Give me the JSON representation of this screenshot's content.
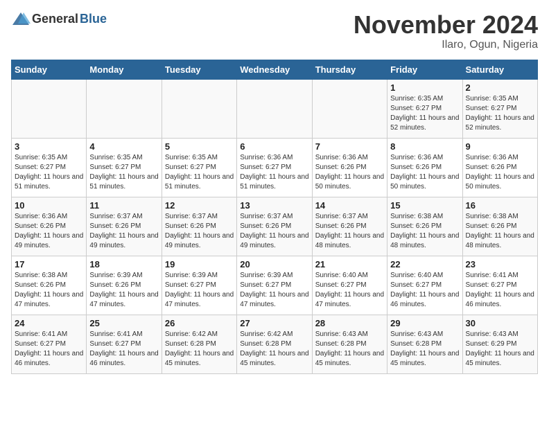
{
  "header": {
    "logo_general": "General",
    "logo_blue": "Blue",
    "month_title": "November 2024",
    "location": "Ilaro, Ogun, Nigeria"
  },
  "calendar": {
    "days_of_week": [
      "Sunday",
      "Monday",
      "Tuesday",
      "Wednesday",
      "Thursday",
      "Friday",
      "Saturday"
    ],
    "weeks": [
      [
        {
          "day": "",
          "info": ""
        },
        {
          "day": "",
          "info": ""
        },
        {
          "day": "",
          "info": ""
        },
        {
          "day": "",
          "info": ""
        },
        {
          "day": "",
          "info": ""
        },
        {
          "day": "1",
          "info": "Sunrise: 6:35 AM\nSunset: 6:27 PM\nDaylight: 11 hours and 52 minutes."
        },
        {
          "day": "2",
          "info": "Sunrise: 6:35 AM\nSunset: 6:27 PM\nDaylight: 11 hours and 52 minutes."
        }
      ],
      [
        {
          "day": "3",
          "info": "Sunrise: 6:35 AM\nSunset: 6:27 PM\nDaylight: 11 hours and 51 minutes."
        },
        {
          "day": "4",
          "info": "Sunrise: 6:35 AM\nSunset: 6:27 PM\nDaylight: 11 hours and 51 minutes."
        },
        {
          "day": "5",
          "info": "Sunrise: 6:35 AM\nSunset: 6:27 PM\nDaylight: 11 hours and 51 minutes."
        },
        {
          "day": "6",
          "info": "Sunrise: 6:36 AM\nSunset: 6:27 PM\nDaylight: 11 hours and 51 minutes."
        },
        {
          "day": "7",
          "info": "Sunrise: 6:36 AM\nSunset: 6:26 PM\nDaylight: 11 hours and 50 minutes."
        },
        {
          "day": "8",
          "info": "Sunrise: 6:36 AM\nSunset: 6:26 PM\nDaylight: 11 hours and 50 minutes."
        },
        {
          "day": "9",
          "info": "Sunrise: 6:36 AM\nSunset: 6:26 PM\nDaylight: 11 hours and 50 minutes."
        }
      ],
      [
        {
          "day": "10",
          "info": "Sunrise: 6:36 AM\nSunset: 6:26 PM\nDaylight: 11 hours and 49 minutes."
        },
        {
          "day": "11",
          "info": "Sunrise: 6:37 AM\nSunset: 6:26 PM\nDaylight: 11 hours and 49 minutes."
        },
        {
          "day": "12",
          "info": "Sunrise: 6:37 AM\nSunset: 6:26 PM\nDaylight: 11 hours and 49 minutes."
        },
        {
          "day": "13",
          "info": "Sunrise: 6:37 AM\nSunset: 6:26 PM\nDaylight: 11 hours and 49 minutes."
        },
        {
          "day": "14",
          "info": "Sunrise: 6:37 AM\nSunset: 6:26 PM\nDaylight: 11 hours and 48 minutes."
        },
        {
          "day": "15",
          "info": "Sunrise: 6:38 AM\nSunset: 6:26 PM\nDaylight: 11 hours and 48 minutes."
        },
        {
          "day": "16",
          "info": "Sunrise: 6:38 AM\nSunset: 6:26 PM\nDaylight: 11 hours and 48 minutes."
        }
      ],
      [
        {
          "day": "17",
          "info": "Sunrise: 6:38 AM\nSunset: 6:26 PM\nDaylight: 11 hours and 47 minutes."
        },
        {
          "day": "18",
          "info": "Sunrise: 6:39 AM\nSunset: 6:26 PM\nDaylight: 11 hours and 47 minutes."
        },
        {
          "day": "19",
          "info": "Sunrise: 6:39 AM\nSunset: 6:27 PM\nDaylight: 11 hours and 47 minutes."
        },
        {
          "day": "20",
          "info": "Sunrise: 6:39 AM\nSunset: 6:27 PM\nDaylight: 11 hours and 47 minutes."
        },
        {
          "day": "21",
          "info": "Sunrise: 6:40 AM\nSunset: 6:27 PM\nDaylight: 11 hours and 47 minutes."
        },
        {
          "day": "22",
          "info": "Sunrise: 6:40 AM\nSunset: 6:27 PM\nDaylight: 11 hours and 46 minutes."
        },
        {
          "day": "23",
          "info": "Sunrise: 6:41 AM\nSunset: 6:27 PM\nDaylight: 11 hours and 46 minutes."
        }
      ],
      [
        {
          "day": "24",
          "info": "Sunrise: 6:41 AM\nSunset: 6:27 PM\nDaylight: 11 hours and 46 minutes."
        },
        {
          "day": "25",
          "info": "Sunrise: 6:41 AM\nSunset: 6:27 PM\nDaylight: 11 hours and 46 minutes."
        },
        {
          "day": "26",
          "info": "Sunrise: 6:42 AM\nSunset: 6:28 PM\nDaylight: 11 hours and 45 minutes."
        },
        {
          "day": "27",
          "info": "Sunrise: 6:42 AM\nSunset: 6:28 PM\nDaylight: 11 hours and 45 minutes."
        },
        {
          "day": "28",
          "info": "Sunrise: 6:43 AM\nSunset: 6:28 PM\nDaylight: 11 hours and 45 minutes."
        },
        {
          "day": "29",
          "info": "Sunrise: 6:43 AM\nSunset: 6:28 PM\nDaylight: 11 hours and 45 minutes."
        },
        {
          "day": "30",
          "info": "Sunrise: 6:43 AM\nSunset: 6:29 PM\nDaylight: 11 hours and 45 minutes."
        }
      ]
    ]
  }
}
